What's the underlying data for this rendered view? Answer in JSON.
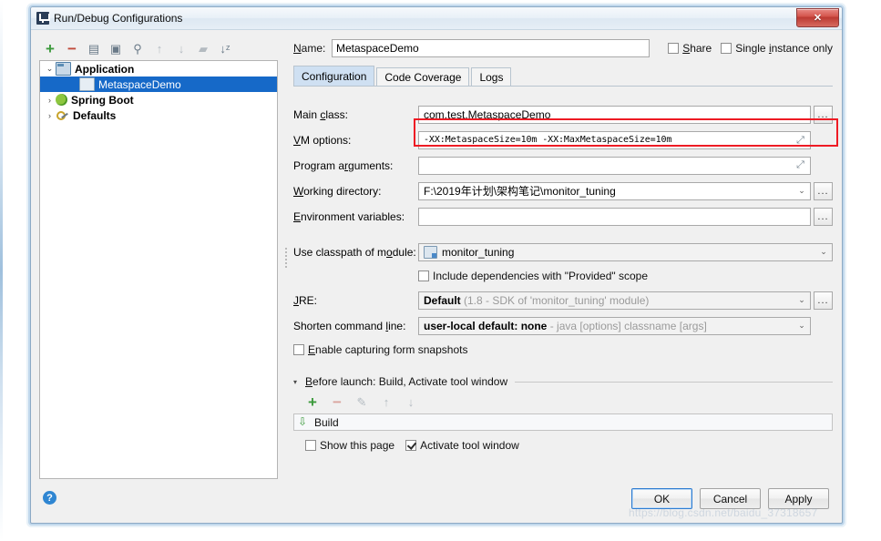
{
  "window": {
    "title": "Run/Debug Configurations",
    "app_icon": "intellij-icon",
    "close_label": "✕"
  },
  "tree_toolbar": {
    "items": [
      {
        "name": "add-configuration-button",
        "glyph": "+",
        "cls": "tb-plus",
        "enabled": true
      },
      {
        "name": "remove-configuration-button",
        "glyph": "−",
        "cls": "tb-minus",
        "enabled": true
      },
      {
        "name": "copy-configuration-button",
        "glyph": "▤",
        "cls": "tb-copy",
        "enabled": true
      },
      {
        "name": "save-configuration-button",
        "glyph": "▣",
        "cls": "tb-save",
        "enabled": true
      },
      {
        "name": "edit-templates-button",
        "glyph": "⚲",
        "cls": "tb-edit",
        "enabled": true
      },
      {
        "name": "move-up-button",
        "glyph": "↑",
        "cls": "tb-up",
        "enabled": false
      },
      {
        "name": "move-down-button",
        "glyph": "↓",
        "cls": "tb-down",
        "enabled": false
      },
      {
        "name": "new-folder-button",
        "glyph": "▰",
        "cls": "tb-folder",
        "enabled": false
      },
      {
        "name": "sort-configurations-button",
        "glyph": "↓ᶻ",
        "cls": "tb-sort",
        "enabled": true
      }
    ]
  },
  "tree": {
    "nodes": [
      {
        "label": "Application",
        "twisty": "⌄",
        "icon": "ico-app",
        "bold": true,
        "indent": 0,
        "selected": false
      },
      {
        "label": "MetaspaceDemo",
        "twisty": "",
        "icon": "ico-run",
        "bold": false,
        "indent": 1,
        "selected": true
      },
      {
        "label": "Spring Boot",
        "twisty": "›",
        "icon": "ico-spring",
        "bold": true,
        "indent": 0,
        "selected": false
      },
      {
        "label": "Defaults",
        "twisty": "›",
        "icon": "ico-defaults",
        "bold": true,
        "indent": 0,
        "selected": false
      }
    ]
  },
  "name_row": {
    "label": "Name:",
    "value": "MetaspaceDemo",
    "share_label": "Share",
    "share_checked": false,
    "single_instance_label": "Single instance only",
    "single_instance_checked": false
  },
  "tabs": [
    {
      "label": "Configuration",
      "active": true
    },
    {
      "label": "Code Coverage",
      "active": false
    },
    {
      "label": "Logs",
      "active": false
    }
  ],
  "form": {
    "main_class": {
      "label": "Main class:",
      "value": "com.test.MetaspaceDemo",
      "browse": "..."
    },
    "vm_options": {
      "label": "VM options:",
      "value": "-XX:MetaspaceSize=10m -XX:MaxMetaspaceSize=10m",
      "expand": "⤢",
      "highlight_color": "#ee1b24"
    },
    "program_arguments": {
      "label": "Program arguments:",
      "value": "",
      "expand": "⤢"
    },
    "working_directory": {
      "label": "Working directory:",
      "value": "F:\\2019年计划\\架构笔记\\monitor_tuning",
      "caret": "⌄",
      "browse": "..."
    },
    "environment_variables": {
      "label": "Environment variables:",
      "value": "",
      "browse": "..."
    },
    "use_classpath_of_module": {
      "label": "Use classpath of module:",
      "value": "monitor_tuning",
      "caret": "⌄"
    },
    "include_provided": {
      "label": "Include dependencies with \"Provided\" scope",
      "checked": false
    },
    "jre": {
      "label": "JRE:",
      "value_bold": "Default",
      "value_grey": "(1.8 - SDK of 'monitor_tuning' module)",
      "caret": "⌄",
      "browse": "..."
    },
    "shorten_command_line": {
      "label": "Shorten command line:",
      "value_bold": "user-local default: none",
      "value_grey": "- java [options] classname [args]",
      "caret": "⌄"
    },
    "enable_form_snapshots": {
      "label": "Enable capturing form snapshots",
      "checked": false
    }
  },
  "before_launch": {
    "title": "Before launch: Build, Activate tool window",
    "triangle": "▾",
    "toolbar": [
      {
        "name": "add-task-button",
        "glyph": "+",
        "cls": "tb-plus",
        "enabled": true
      },
      {
        "name": "remove-task-button",
        "glyph": "−",
        "cls": "tb-minus",
        "enabled": false
      },
      {
        "name": "edit-task-button",
        "glyph": "✎",
        "cls": "tb-edit",
        "enabled": false
      },
      {
        "name": "move-task-up-button",
        "glyph": "↑",
        "cls": "tb-up",
        "enabled": false
      },
      {
        "name": "move-task-down-button",
        "glyph": "↓",
        "cls": "tb-down",
        "enabled": false
      }
    ],
    "task": {
      "icon": "build-icon",
      "label": "Build"
    },
    "show_this_page": {
      "label": "Show this page",
      "checked": false
    },
    "activate_tool_window": {
      "label": "Activate tool window",
      "checked": true
    }
  },
  "bottom": {
    "help": "?",
    "buttons": [
      {
        "label": "OK",
        "default": true
      },
      {
        "label": "Cancel",
        "default": false
      },
      {
        "label": "Apply",
        "default": false
      }
    ]
  },
  "watermark": "https://blog.csdn.net/baidu_37318657"
}
